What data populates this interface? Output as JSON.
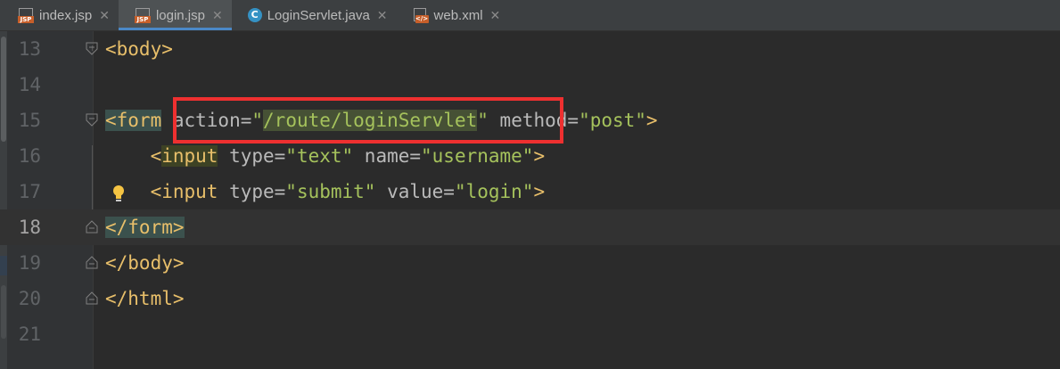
{
  "tabs": [
    {
      "label": "index.jsp",
      "icon": "jsp-file-icon",
      "active": false
    },
    {
      "label": "login.jsp",
      "icon": "jsp-file-icon",
      "active": true
    },
    {
      "label": "LoginServlet.java",
      "icon": "java-class-icon",
      "active": false
    },
    {
      "label": "web.xml",
      "icon": "xml-file-icon",
      "active": false
    }
  ],
  "close_glyph": "✕",
  "java_icon_letter": "C",
  "colors": {
    "background": "#2b2b2b",
    "tag": "#e8bf6a",
    "attribute": "#bababa",
    "string": "#a5c25c",
    "highlight_box": "#ee3030",
    "active_tab_underline": "#4a88c7"
  },
  "editor": {
    "current_line": 18,
    "lines": [
      {
        "n": "13",
        "t1": "<body>"
      },
      {
        "n": "14"
      },
      {
        "n": "15",
        "t1": "<form",
        "a1": " action=",
        "v1": "\"",
        "v1b": "/route/loginServlet",
        "v1c": "\"",
        "a2": " method=",
        "v2": "\"post\"",
        "t2": ">"
      },
      {
        "n": "16",
        "t1": "    <",
        "t1b": "input",
        "a1": " type=",
        "v1": "\"text\"",
        "a2": " name=",
        "v2": "\"username\"",
        "t2": ">"
      },
      {
        "n": "17",
        "t1": "    <input",
        "a1": " type=",
        "v1": "\"submit\"",
        "a2": " value=",
        "v2": "\"login\"",
        "t2": ">"
      },
      {
        "n": "18",
        "t1": "</form>"
      },
      {
        "n": "19",
        "t1": "</body>"
      },
      {
        "n": "20",
        "t1": "</html>"
      },
      {
        "n": "21"
      }
    ]
  }
}
